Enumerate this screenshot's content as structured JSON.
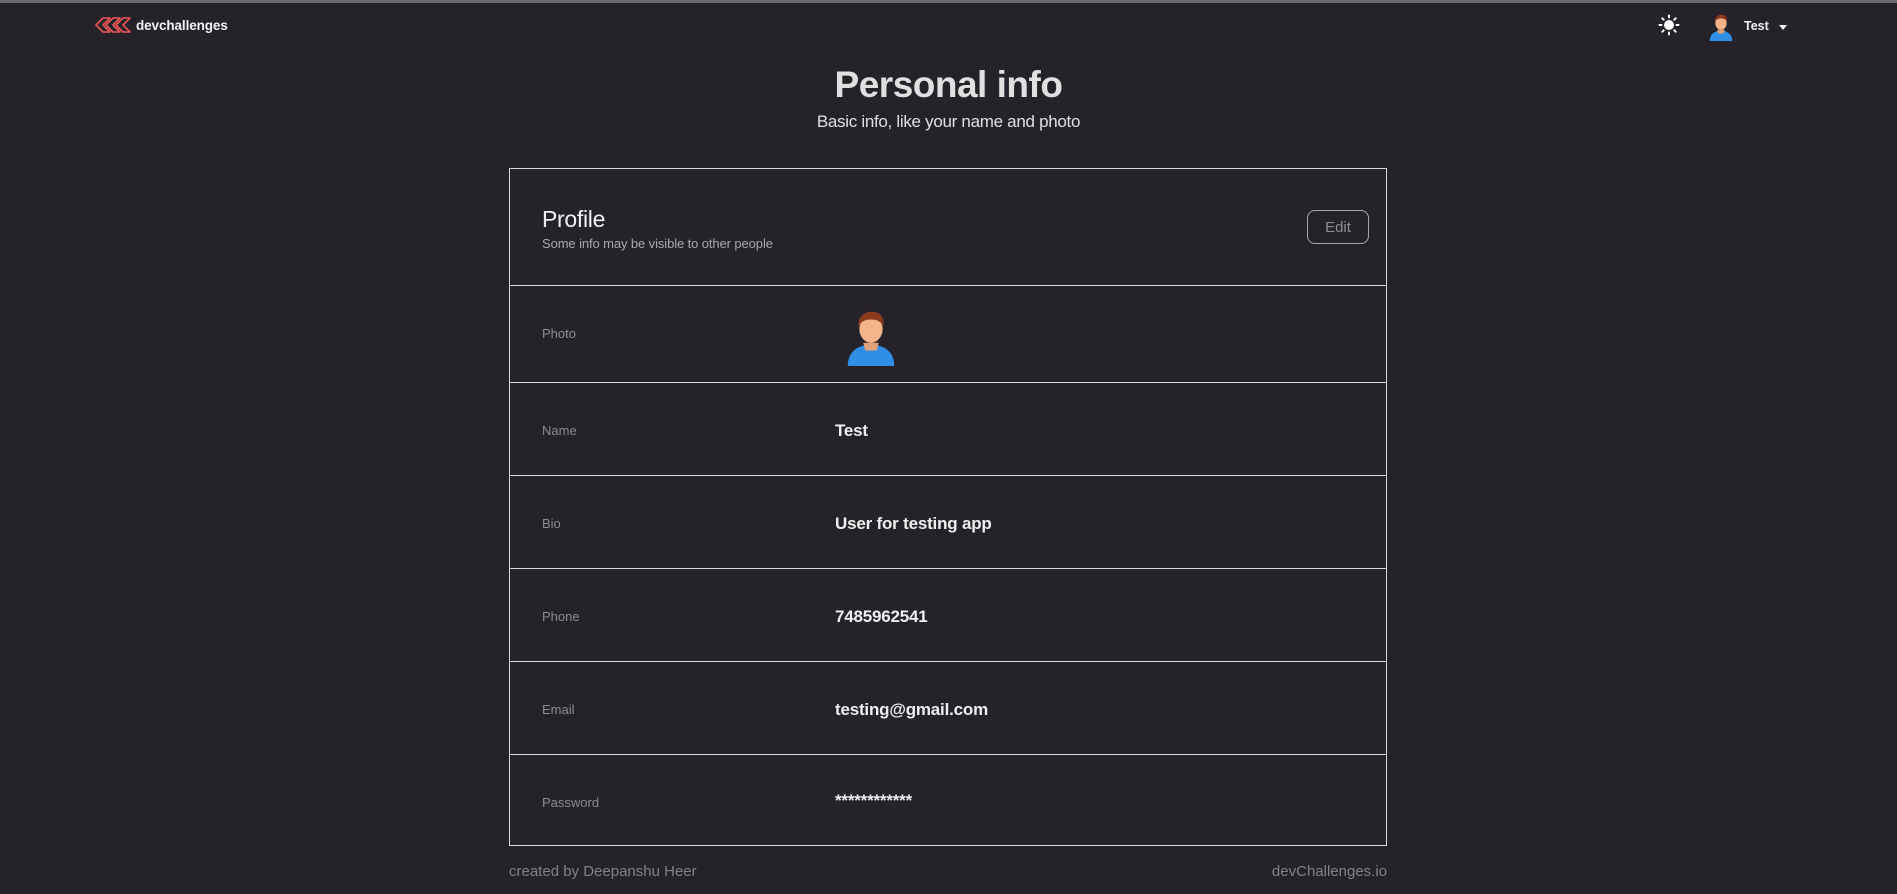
{
  "header": {
    "logo_text": "devchallenges",
    "logo_icon": "devchallenges-logo",
    "theme_icon": "sun-icon",
    "user": {
      "name": "Test",
      "avatar_icon": "user-avatar-icon"
    }
  },
  "page": {
    "title": "Personal info",
    "subtitle": "Basic info, like your name and photo"
  },
  "profile": {
    "title": "Profile",
    "description": "Some info may be visible to other people",
    "edit_label": "Edit",
    "rows": {
      "photo": {
        "label": "Photo"
      },
      "name": {
        "label": "Name",
        "value": "Test"
      },
      "bio": {
        "label": "Bio",
        "value": "User for testing app"
      },
      "phone": {
        "label": "Phone",
        "value": "7485962541"
      },
      "email": {
        "label": "Email",
        "value": "testing@gmail.com"
      },
      "password": {
        "label": "Password",
        "value": "************"
      }
    }
  },
  "footer": {
    "credit": "created by Deepanshu Heer",
    "site": "devChallenges.io"
  },
  "colors": {
    "background": "#252329",
    "border": "#d8d8d8",
    "logo_red": "#EB5757",
    "text_primary": "#E0E0E0",
    "text_muted": "#828282"
  }
}
